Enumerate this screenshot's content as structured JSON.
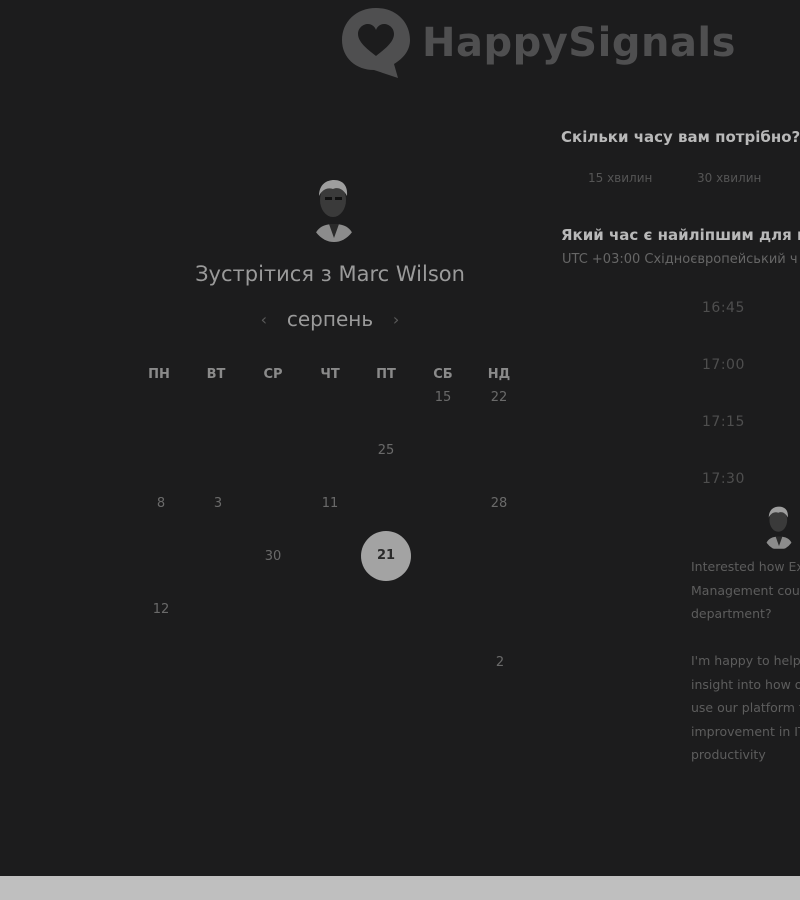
{
  "brand": {
    "name": "HappySignals"
  },
  "host": {
    "title": "Зустрітися з Marc Wilson"
  },
  "calendar": {
    "month": "серпень",
    "weekdays": [
      "ПН",
      "ВТ",
      "СР",
      "ЧТ",
      "ПТ",
      "СБ",
      "НД"
    ],
    "days": {
      "d15": "15",
      "d22": "22",
      "d25": "25",
      "d8": "8",
      "d3": "3",
      "d11": "11",
      "d28": "28",
      "d30": "30",
      "d21": "21",
      "d12": "12",
      "d2": "2"
    },
    "selected_day": "21"
  },
  "duration": {
    "question": "Скільки часу вам потрібно?",
    "options": [
      "15 хвилин",
      "30 хвилин"
    ]
  },
  "time": {
    "question": "Який час є найліпшим для вас",
    "timezone": "UTC +03:00 Східноєвропейський ч",
    "slots": [
      "16:45",
      "17:00",
      "17:15",
      "17:30"
    ]
  },
  "description": {
    "p1": [
      "Interested how Ex",
      "Management cou",
      "department?"
    ],
    "p2": [
      "I'm happy to help",
      "insight into how o",
      "use our platform t",
      "improvement in IT",
      "productivity"
    ]
  }
}
